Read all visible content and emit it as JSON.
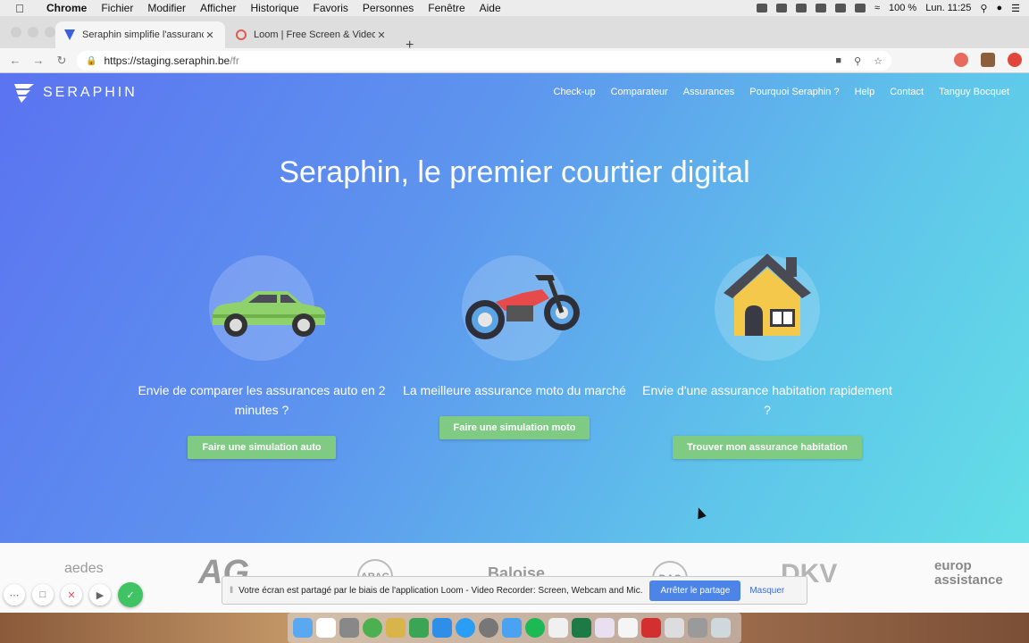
{
  "menubar": {
    "app": "Chrome",
    "items": [
      "Fichier",
      "Modifier",
      "Afficher",
      "Historique",
      "Favoris",
      "Personnes",
      "Fenêtre",
      "Aide"
    ],
    "battery": "100 %",
    "clock": "Lun. 11:25"
  },
  "tabs": [
    {
      "title": "Seraphin simplifie l'assurance",
      "close": "✕"
    },
    {
      "title": "Loom | Free Screen & Video Re",
      "close": "✕"
    }
  ],
  "new_tab": "+",
  "address": {
    "host": "https://staging.seraphin.be",
    "path": "/fr"
  },
  "site": {
    "brand": "SERAPHIN",
    "nav": [
      "Check-up",
      "Comparateur",
      "Assurances",
      "Pourquoi Seraphin ?",
      "Help",
      "Contact",
      "Tanguy Bocquet"
    ],
    "hero_title": "Seraphin, le premier courtier digital",
    "cards": [
      {
        "icon": "car-icon",
        "text": "Envie de comparer les assurances auto en 2 minutes ?",
        "button": "Faire une simulation auto"
      },
      {
        "icon": "motorbike-icon",
        "text": "La meilleure assurance moto du marché",
        "button": "Faire une simulation moto"
      },
      {
        "icon": "house-icon",
        "text": "Envie d'une assurance habitation rapidement ?",
        "button": "Trouver mon assurance habitation"
      }
    ],
    "partners": [
      "aedes",
      "AG",
      "ARAG",
      "Baloise",
      "DAS",
      "DKV",
      "europ assistance"
    ]
  },
  "loom": {
    "share_text": "Votre écran est partagé par le biais de l'application Loom - Video Recorder: Screen, Webcam and Mic.",
    "stop_label": "Arrêter le partage",
    "hide_label": "Masquer",
    "controls": [
      "more",
      "camera",
      "cancel",
      "pause",
      "done"
    ]
  },
  "colors": {
    "accent_green": "#7fcb84",
    "gradient_start": "#5b73f1",
    "gradient_end": "#63dfe6",
    "loom_blue": "#4c84e8"
  }
}
